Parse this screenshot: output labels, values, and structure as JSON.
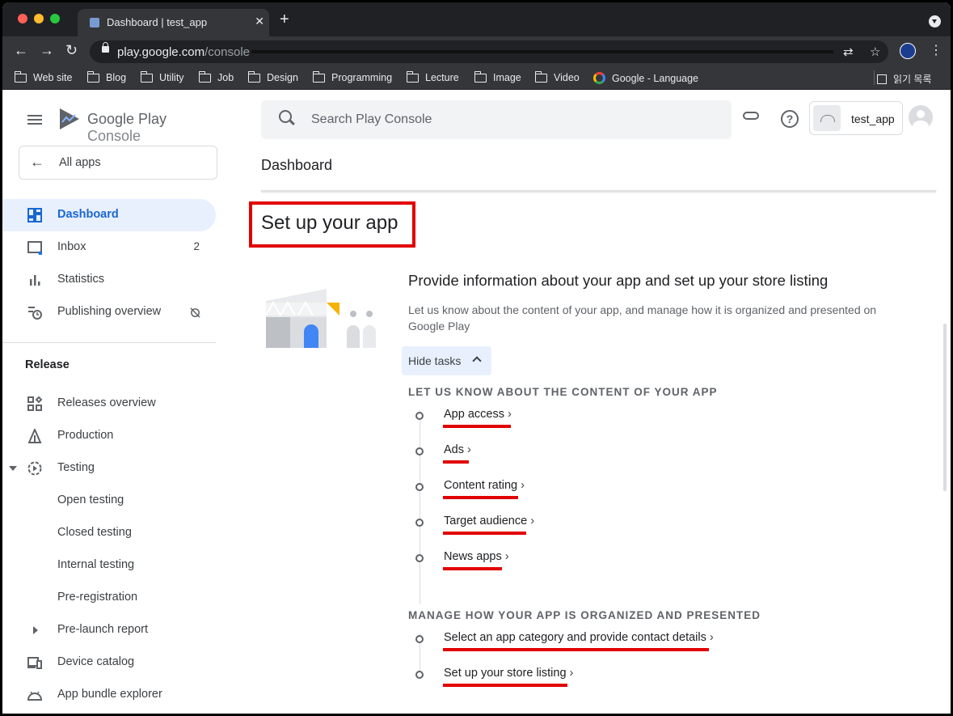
{
  "browser": {
    "tab_title": "Dashboard | test_app",
    "url_host": "play.google.com",
    "url_path": "/console",
    "bookmarks": [
      "Web site",
      "Blog",
      "Utility",
      "Job",
      "Design",
      "Programming",
      "Lecture",
      "Image",
      "Video",
      "Google - Language"
    ],
    "reading_list": "읽기 목록"
  },
  "brand": {
    "name": "Google Play",
    "suffix": "Console"
  },
  "sidebar": {
    "all_apps": "All apps",
    "items": [
      {
        "label": "Dashboard",
        "icon": "dashboard-icon",
        "active": true
      },
      {
        "label": "Inbox",
        "icon": "inbox-icon",
        "count": "2"
      },
      {
        "label": "Statistics",
        "icon": "bar-chart-icon"
      },
      {
        "label": "Publishing overview",
        "icon": "publishing-icon"
      }
    ],
    "release_section": "Release",
    "release_items": [
      {
        "label": "Releases overview",
        "icon": "releases-icon"
      },
      {
        "label": "Production",
        "icon": "production-icon"
      },
      {
        "label": "Testing",
        "icon": "testing-icon"
      },
      {
        "label": "Open testing"
      },
      {
        "label": "Closed testing"
      },
      {
        "label": "Internal testing"
      },
      {
        "label": "Pre-registration"
      },
      {
        "label": "Pre-launch report"
      },
      {
        "label": "Device catalog",
        "icon": "devices-icon"
      },
      {
        "label": "App bundle explorer",
        "icon": "android-icon"
      }
    ]
  },
  "header": {
    "search_placeholder": "Search Play Console",
    "app_name": "test_app",
    "page_title": "Dashboard"
  },
  "main": {
    "section_title": "Set up your app",
    "card_title": "Provide information about your app and set up your store listing",
    "card_desc": "Let us know about the content of your app, and manage how it is organized and presented on Google Play",
    "hide_tasks": "Hide tasks",
    "group1_title": "LET US KNOW ABOUT THE CONTENT OF YOUR APP",
    "group1_tasks": [
      "App access",
      "Ads",
      "Content rating",
      "Target audience",
      "News apps"
    ],
    "group2_title": "MANAGE HOW YOUR APP IS ORGANIZED AND PRESENTED",
    "group2_tasks": [
      "Select an app category and provide contact details",
      "Set up your store listing"
    ]
  },
  "colors": {
    "accent": "#1967d2",
    "highlight": "#e20000",
    "active_bg": "#e8f0fe"
  }
}
